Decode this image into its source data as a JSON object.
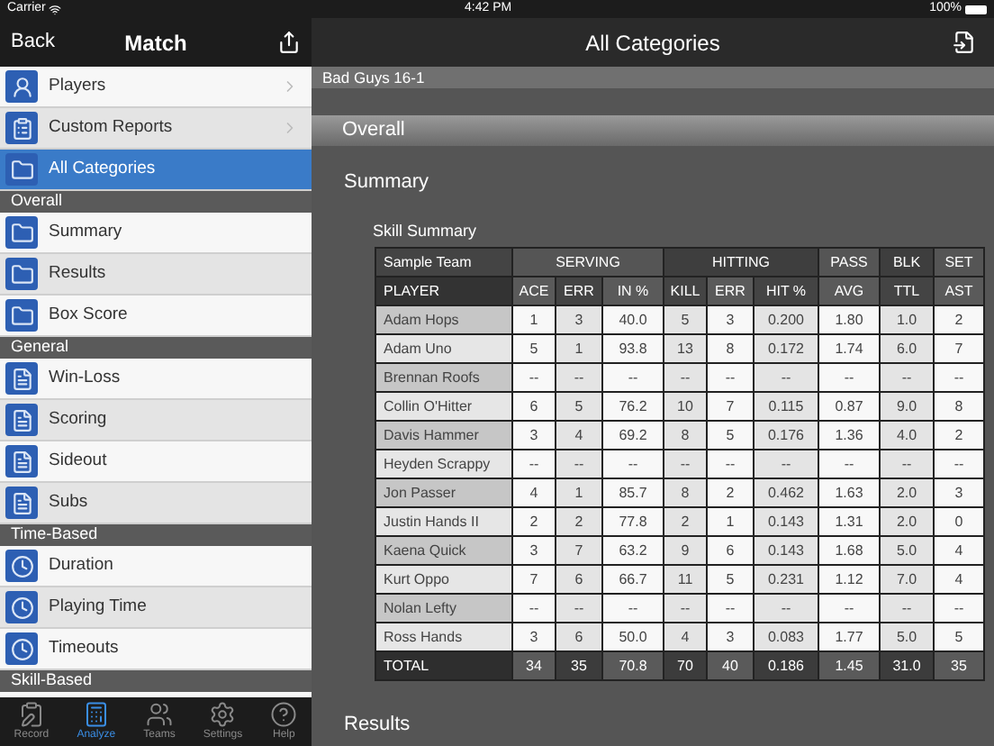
{
  "status_bar": {
    "carrier": "Carrier",
    "time": "4:42 PM",
    "battery": "100%"
  },
  "sidebar": {
    "back": "Back",
    "title": "Match",
    "nav_items": [
      {
        "label": "Players",
        "kind": "player",
        "chevron": true,
        "selected": false
      },
      {
        "label": "Custom Reports",
        "kind": "report",
        "chevron": true,
        "selected": false
      },
      {
        "label": "All Categories",
        "kind": "folder",
        "chevron": false,
        "selected": true
      }
    ],
    "sections": [
      {
        "header": "Overall",
        "items": [
          {
            "label": "Summary",
            "kind": "folder"
          },
          {
            "label": "Results",
            "kind": "folder"
          },
          {
            "label": "Box Score",
            "kind": "folder"
          }
        ]
      },
      {
        "header": "General",
        "items": [
          {
            "label": "Win-Loss",
            "kind": "doc"
          },
          {
            "label": "Scoring",
            "kind": "doc"
          },
          {
            "label": "Sideout",
            "kind": "doc"
          },
          {
            "label": "Subs",
            "kind": "doc"
          }
        ]
      },
      {
        "header": "Time-Based",
        "items": [
          {
            "label": "Duration",
            "kind": "clock"
          },
          {
            "label": "Playing Time",
            "kind": "clock"
          },
          {
            "label": "Timeouts",
            "kind": "clock"
          }
        ]
      },
      {
        "header": "Skill-Based"
      }
    ]
  },
  "tab_bar": [
    {
      "label": "Record",
      "kind": "record",
      "selected": false
    },
    {
      "label": "Analyze",
      "kind": "analyze",
      "selected": true
    },
    {
      "label": "Teams",
      "kind": "teams",
      "selected": false
    },
    {
      "label": "Settings",
      "kind": "settings",
      "selected": false
    },
    {
      "label": "Help",
      "kind": "help",
      "selected": false
    }
  ],
  "main": {
    "title": "All Categories",
    "match": "Bad Guys 16-1",
    "section": "Overall",
    "subsection": "Summary",
    "table_title": "Skill Summary",
    "table": {
      "team": "Sample Team",
      "groups": [
        "SERVING",
        "HITTING",
        "PASS",
        "BLK",
        "SET"
      ],
      "columns": [
        "PLAYER",
        "ACE",
        "ERR",
        "IN %",
        "KILL",
        "ERR",
        "HIT %",
        "AVG",
        "TTL",
        "AST"
      ],
      "rows": [
        [
          "Adam Hops",
          "1",
          "3",
          "40.0",
          "5",
          "3",
          "0.200",
          "1.80",
          "1.0",
          "2"
        ],
        [
          "Adam Uno",
          "5",
          "1",
          "93.8",
          "13",
          "8",
          "0.172",
          "1.74",
          "6.0",
          "7"
        ],
        [
          "Brennan Roofs",
          "--",
          "--",
          "--",
          "--",
          "--",
          "--",
          "--",
          "--",
          "--"
        ],
        [
          "Collin O'Hitter",
          "6",
          "5",
          "76.2",
          "10",
          "7",
          "0.115",
          "0.87",
          "9.0",
          "8"
        ],
        [
          "Davis Hammer",
          "3",
          "4",
          "69.2",
          "8",
          "5",
          "0.176",
          "1.36",
          "4.0",
          "2"
        ],
        [
          "Heyden Scrappy",
          "--",
          "--",
          "--",
          "--",
          "--",
          "--",
          "--",
          "--",
          "--"
        ],
        [
          "Jon Passer",
          "4",
          "1",
          "85.7",
          "8",
          "2",
          "0.462",
          "1.63",
          "2.0",
          "3"
        ],
        [
          "Justin Hands II",
          "2",
          "2",
          "77.8",
          "2",
          "1",
          "0.143",
          "1.31",
          "2.0",
          "0"
        ],
        [
          "Kaena Quick",
          "3",
          "7",
          "63.2",
          "9",
          "6",
          "0.143",
          "1.68",
          "5.0",
          "4"
        ],
        [
          "Kurt Oppo",
          "7",
          "6",
          "66.7",
          "11",
          "5",
          "0.231",
          "1.12",
          "7.0",
          "4"
        ],
        [
          "Nolan Lefty",
          "--",
          "--",
          "--",
          "--",
          "--",
          "--",
          "--",
          "--",
          "--"
        ],
        [
          "Ross Hands",
          "3",
          "6",
          "50.0",
          "4",
          "3",
          "0.083",
          "1.77",
          "5.0",
          "5"
        ]
      ],
      "total": [
        "TOTAL",
        "34",
        "35",
        "70.8",
        "70",
        "40",
        "0.186",
        "1.45",
        "31.0",
        "35"
      ]
    },
    "next_subsection": "Results"
  }
}
